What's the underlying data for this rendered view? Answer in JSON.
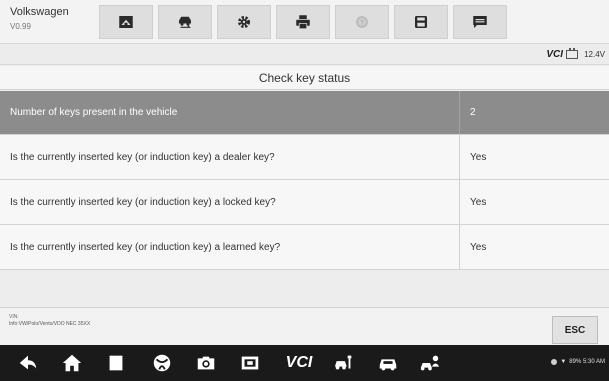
{
  "header": {
    "brand_name": "Volkswagen",
    "version": "V0.99"
  },
  "toolbar": {
    "icons": [
      "home-icon",
      "vehicle-swap-icon",
      "settings-icon",
      "print-icon",
      "help-icon",
      "save-icon",
      "message-icon"
    ]
  },
  "status": {
    "vci": "VCI",
    "voltage": "12.4V"
  },
  "page": {
    "title": "Check key status"
  },
  "table": {
    "header": {
      "question": "Number of keys present in the vehicle",
      "answer": "2"
    },
    "rows": [
      {
        "question": "Is the currently inserted key (or induction key) a dealer key?",
        "answer": "Yes"
      },
      {
        "question": "Is the currently inserted key (or induction key) a locked key?",
        "answer": "Yes"
      },
      {
        "question": "Is the currently inserted key (or induction key) a learned key?",
        "answer": "Yes"
      }
    ]
  },
  "footer": {
    "vin_label": "VIN:",
    "vehicle_info": "Info:VW/Polo/Vento/VDO NEC 35XX",
    "esc_label": "ESC"
  },
  "android": {
    "vcl_label": "VCI",
    "status_text": "89% 5:30 AM"
  },
  "colors": {
    "header_row_bg": "#8c8c8c",
    "android_bar_bg": "#1a1a1a"
  }
}
